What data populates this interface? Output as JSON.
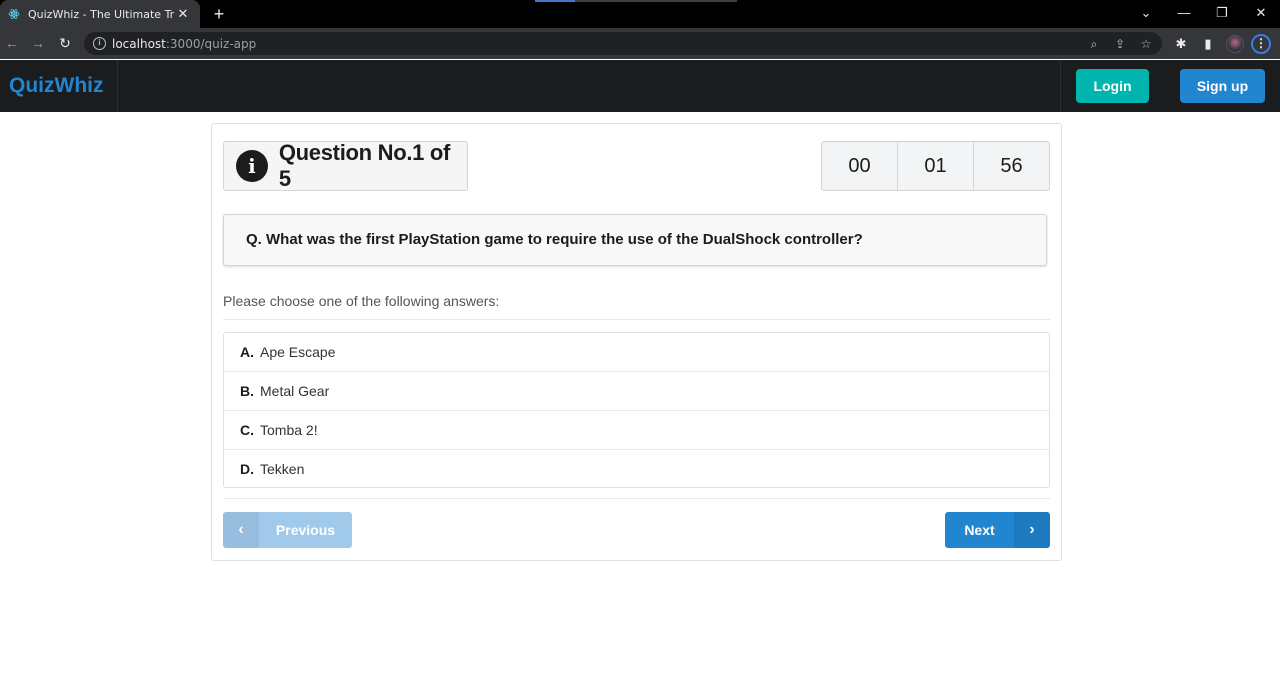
{
  "browser": {
    "tab_title": "QuizWhiz - The Ultimate Trivia Q",
    "url_host": "localhost",
    "url_rest": ":3000/quiz-app"
  },
  "navbar": {
    "brand": "QuizWhiz",
    "login_label": "Login",
    "signup_label": "Sign up"
  },
  "quiz": {
    "header": "Question No.1 of 5",
    "timer": {
      "hours": "00",
      "minutes": "01",
      "seconds": "56"
    },
    "question": "Q. What was the first PlayStation game to require the use of the DualShock controller?",
    "prompt": "Please choose one of the following answers:",
    "answers": [
      {
        "letter": "A.",
        "text": "Ape Escape"
      },
      {
        "letter": "B.",
        "text": "Metal Gear"
      },
      {
        "letter": "C.",
        "text": "Tomba 2!"
      },
      {
        "letter": "D.",
        "text": "Tekken"
      }
    ],
    "previous_label": "Previous",
    "next_label": "Next"
  },
  "colors": {
    "primary": "#2185d0",
    "teal": "#00b5ad",
    "navbar_bg": "#1b1c1d",
    "disabled_primary": "#a0c9ea"
  }
}
